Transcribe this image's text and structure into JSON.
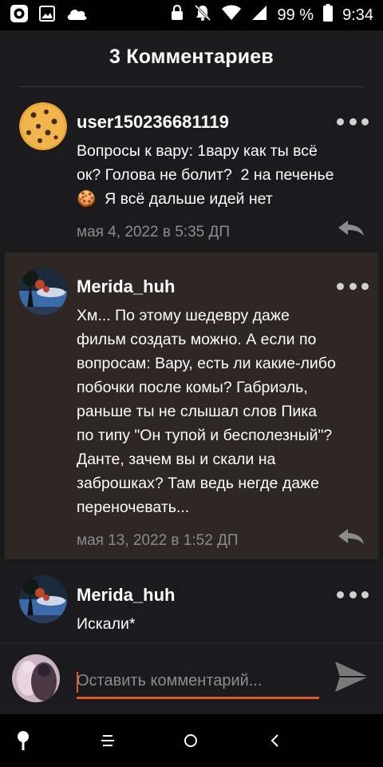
{
  "status_bar": {
    "battery_percent": "99 %",
    "time": "9:34",
    "icons": [
      "app-icon",
      "image-icon",
      "cloud-icon",
      "lock-icon",
      "bell-off-icon",
      "wifi-icon",
      "signal-icon",
      "battery-icon"
    ]
  },
  "header": {
    "title": "3 Комментариев"
  },
  "comments": [
    {
      "username": "user150236681119",
      "text_parts": [
        "Вопросы к вару: 1вару как ты всё\nок? Голова не болит?  2 на печенье\n",
        "  Я всё дальше идей нет"
      ],
      "emoji": "🍪",
      "date": "мая 4, 2022 в 5:35 ДП"
    },
    {
      "username": "Merida_huh",
      "text": "Хм... По этому шедевру даже\nфильм создать можно. А если по\nвопросам: Вару, есть ли какие-либо\nпобочки после комы? Габриэль,\nраньше ты не слышал слов Пика\nпо типу \"Он тупой и бесполезный\"?\nДанте, зачем вы и скали на\nзаброшках? Там ведь негде даже\nпереночевать...",
      "date": "мая 13, 2022 в 1:52 ДП"
    },
    {
      "username": "Merida_huh",
      "text": "Искали*"
    }
  ],
  "input": {
    "placeholder": "Оставить комментарий..."
  },
  "colors": {
    "accent": "#e05a30",
    "background": "#1b1b1d",
    "highlight": "#2e2723",
    "muted": "#8c8c8c"
  },
  "nav_bar": {
    "icons": [
      "assistant-icon",
      "recent-apps-icon",
      "home-icon",
      "back-icon"
    ]
  }
}
